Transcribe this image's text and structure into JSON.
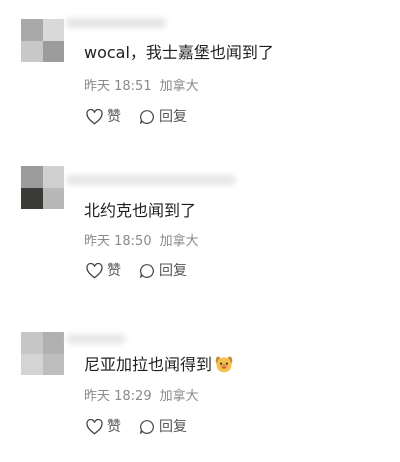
{
  "comments": [
    {
      "text": "wocal，我士嘉堡也闻到了",
      "time": "昨天 18:51",
      "location": "加拿大",
      "like_label": "赞",
      "reply_label": "回复",
      "avatar_colors": [
        "#a9a9a9",
        "#d9d9d9",
        "#c8c8c8",
        "#9c9c9c"
      ],
      "name_blur_color": "#e4e4e4"
    },
    {
      "text": "北约克也闻到了",
      "time": "昨天 18:50",
      "location": "加拿大",
      "like_label": "赞",
      "reply_label": "回复",
      "avatar_colors": [
        "#9b9b9b",
        "#cfcfcf",
        "#3c3a36",
        "#b8b8b8"
      ],
      "name_blur_color": "#e6e6e6"
    },
    {
      "text": "尼亚加拉也闻得到",
      "emoji": "smiling-dog-emoji",
      "time": "昨天 18:29",
      "location": "加拿大",
      "like_label": "赞",
      "reply_label": "回复",
      "avatar_colors": [
        "#c6c6c6",
        "#b0b0b0",
        "#d4d4d4",
        "#bdbdbd"
      ],
      "name_blur_color": "#e6e6e6"
    }
  ]
}
